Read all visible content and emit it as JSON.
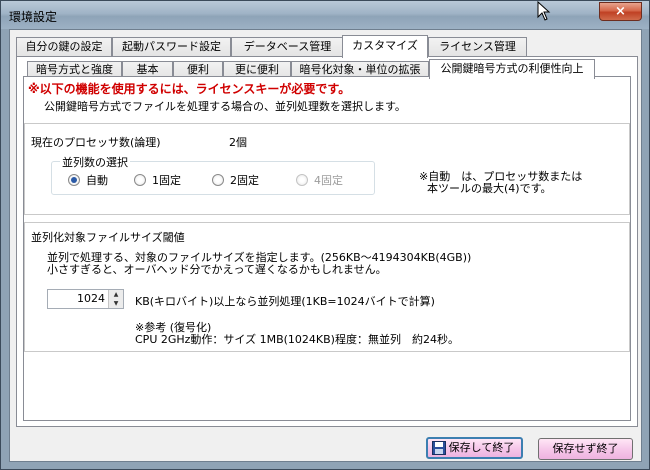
{
  "window": {
    "title": "環境設定",
    "close_glyph": "×"
  },
  "outer_tabs": [
    {
      "label": "自分の鍵の設定"
    },
    {
      "label": "起動パスワード設定"
    },
    {
      "label": "データベース管理"
    },
    {
      "label": "カスタマイズ"
    },
    {
      "label": "ライセンス管理"
    }
  ],
  "outer_active": "カスタマイズ",
  "inner_tabs": [
    {
      "label": "暗号方式と強度"
    },
    {
      "label": "基本"
    },
    {
      "label": "便利"
    },
    {
      "label": "更に便利"
    },
    {
      "label": "暗号化対象・単位の拡張"
    },
    {
      "label": "公開鍵暗号方式の利便性向上"
    }
  ],
  "inner_active": "公開鍵暗号方式の利便性向上",
  "content": {
    "warning": "※以下の機能を使用するには、ライセンスキーが必要です。",
    "description": "公開鍵暗号方式でファイルを処理する場合の、並列処理数を選択します。",
    "processor": {
      "label": "現在のプロセッサ数(論理)",
      "value": "2個"
    },
    "parallel": {
      "group_title": "並列数の選択",
      "options": [
        {
          "label": "自動",
          "checked": true,
          "disabled": false
        },
        {
          "label": "1固定",
          "checked": false,
          "disabled": false
        },
        {
          "label": "2固定",
          "checked": false,
          "disabled": false
        },
        {
          "label": "4固定",
          "checked": false,
          "disabled": true
        }
      ],
      "note_line1": "※自動　は、プロセッサ数または",
      "note_line2": "本ツールの最大(4)です。"
    },
    "threshold": {
      "title": "並列化対象ファイルサイズ閾値",
      "desc_line1": "並列で処理する、対象のファイルサイズを指定します。(256KB～4194304KB(4GB))",
      "desc_line2": "小さすぎると、オーバヘッド分でかえって遅くなるかもしれません。",
      "value": "1024",
      "unit_text": "KB(キロバイト)以上なら並列処理(1KB=1024バイトで計算)",
      "ref_title": "※参考 (復号化)",
      "ref_text": "CPU 2GHz動作：サイズ 1MB(1024KB)程度：無並列　約24秒。"
    }
  },
  "buttons": {
    "save_exit": "保存して終了",
    "exit_no_save": "保存せず終了"
  },
  "colors": {
    "warning": "#d00000",
    "button_bg": "#f6c8ea"
  }
}
